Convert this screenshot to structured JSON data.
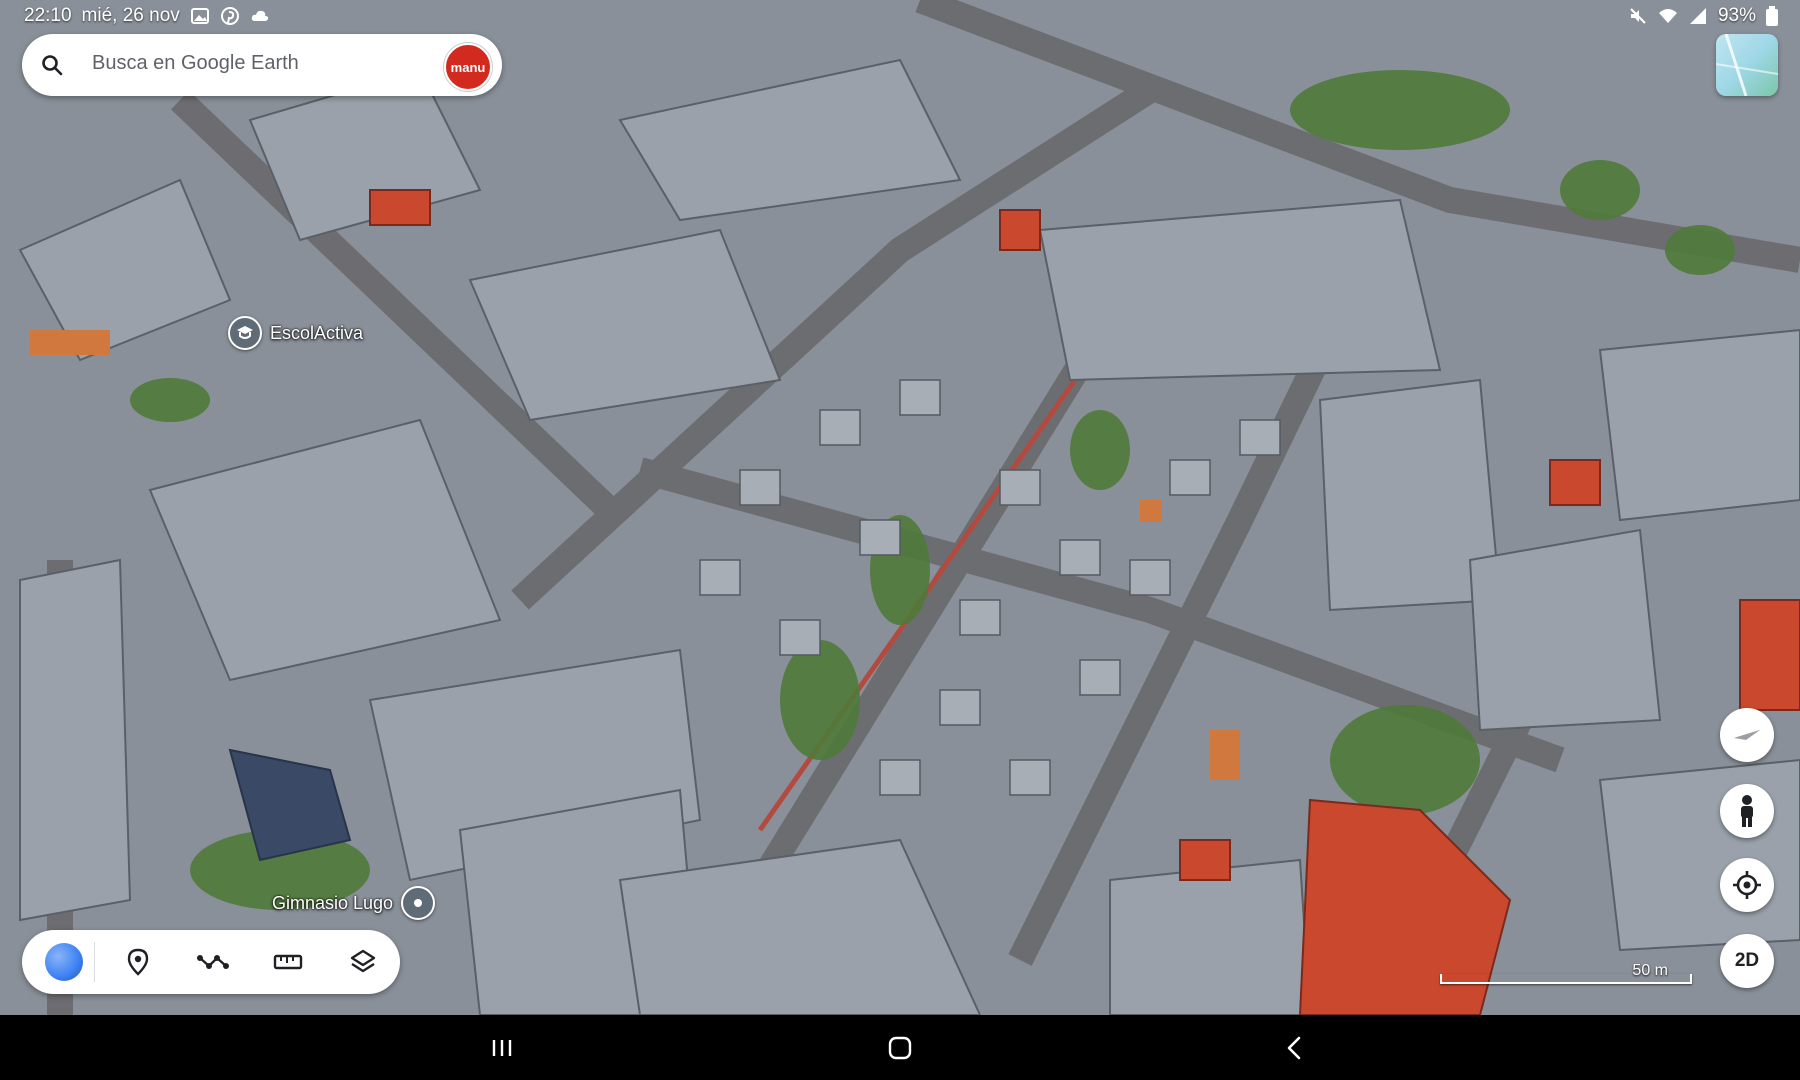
{
  "status_bar": {
    "time": "22:10",
    "date": "mié, 26 nov",
    "battery": "93%",
    "icons_left": [
      "gallery-icon",
      "pinterest-icon",
      "cloud-icon"
    ],
    "icons_right": [
      "mute-icon",
      "wifi-icon",
      "signal-icon",
      "battery-icon"
    ]
  },
  "search": {
    "placeholder": "Busca en Google Earth",
    "avatar_text": "manu"
  },
  "places": [
    {
      "name": "EscolActiva",
      "icon": "school-icon"
    },
    {
      "name": "Gimnasio Lugo",
      "icon": "place-pin-icon"
    }
  ],
  "controls": {
    "compass": "compass-icon",
    "street_view": "pegman-icon",
    "my_location": "my-location-icon",
    "view_toggle_label": "2D"
  },
  "scale": {
    "label": "50 m"
  },
  "toolbar": {
    "items": [
      {
        "name": "earth-menu",
        "icon": "earth-icon"
      },
      {
        "name": "places",
        "icon": "pin-icon"
      },
      {
        "name": "measure-path",
        "icon": "path-icon"
      },
      {
        "name": "measure-ruler",
        "icon": "ruler-icon"
      },
      {
        "name": "layers",
        "icon": "layers-icon"
      }
    ]
  },
  "navigation": [
    "recent-apps-icon",
    "home-icon",
    "back-icon"
  ],
  "colors": {
    "roof_grey": "#8d949d",
    "roof_red": "#c9482e",
    "vegetation": "#4f7a3a",
    "road": "#6e6e70",
    "accent_red": "#d22a1f"
  }
}
